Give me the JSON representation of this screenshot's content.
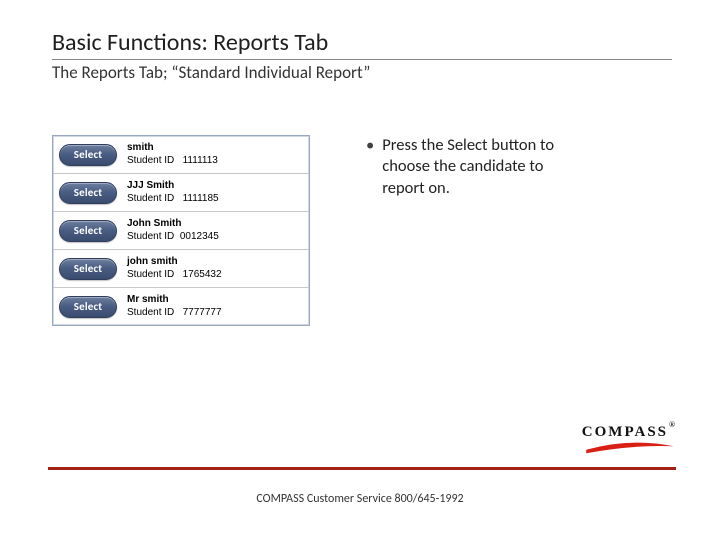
{
  "title": "Basic Functions: Reports Tab",
  "subtitle": "The Reports Tab; “Standard Individual Report”",
  "select_label": "Select",
  "id_label": "Student ID",
  "candidates": [
    {
      "name": "smith",
      "id": "1111113"
    },
    {
      "name": "JJJ Smith",
      "id": "1111185"
    },
    {
      "name": "John Smith",
      "id": "0012345"
    },
    {
      "name": "john smith",
      "id": "1765432"
    },
    {
      "name": "Mr smith",
      "id": "7777777"
    }
  ],
  "bullet": "Press the Select button to choose the candidate to report on.",
  "brand": "COMPASS",
  "footer": "COMPASS Customer Service 800/645-1992"
}
